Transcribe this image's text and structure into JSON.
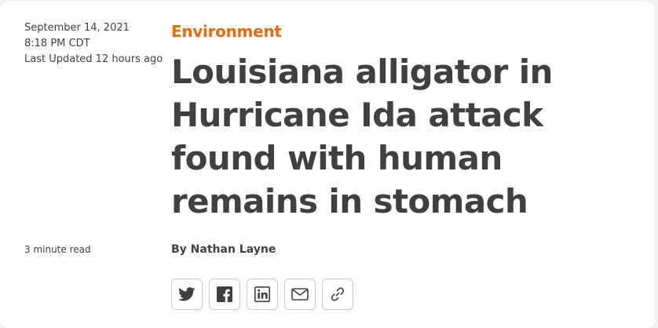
{
  "article": {
    "date": "September 14, 2021",
    "time": "8:18 PM CDT",
    "last_updated": "Last Updated 12 hours ago",
    "category": "Environment",
    "headline": "Louisiana alligator in Hurricane Ida attack found with human remains in stomach",
    "read_time": "3 minute read",
    "byline_prefix": "By",
    "author": "Nathan Layne"
  },
  "share": {
    "buttons": [
      {
        "icon": "twitter-icon"
      },
      {
        "icon": "facebook-icon"
      },
      {
        "icon": "linkedin-icon"
      },
      {
        "icon": "email-icon"
      },
      {
        "icon": "link-icon"
      }
    ]
  },
  "colors": {
    "accent": "#e86c0e",
    "text": "#404040",
    "icon": "#404040",
    "border": "#c8c8c8",
    "page_background": "#f2f2f2",
    "card_background": "#ffffff"
  }
}
